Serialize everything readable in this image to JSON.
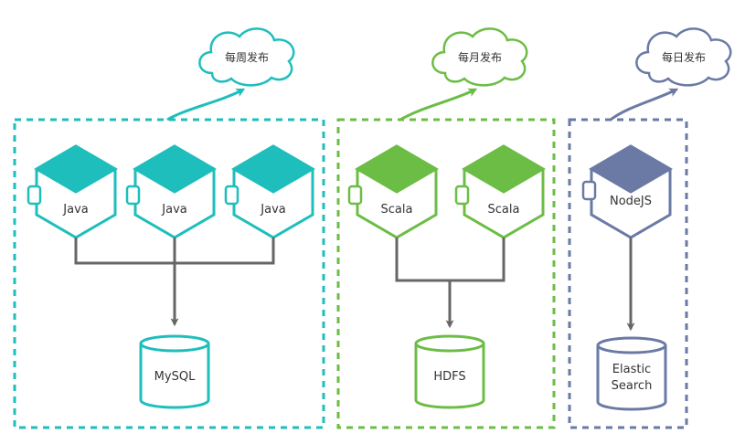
{
  "colors": {
    "teal": "#1ebebc",
    "green": "#6cbd45",
    "slate": "#6a7aa4",
    "connector": "#666666",
    "text": "#333333",
    "background": "#ffffff"
  },
  "groups": [
    {
      "id": "weekly",
      "color": "#1ebebc",
      "cloud_label": "每周发布",
      "services": [
        "Java",
        "Java",
        "Java"
      ],
      "storage": [
        "MySQL"
      ]
    },
    {
      "id": "monthly",
      "color": "#6cbd45",
      "cloud_label": "每月发布",
      "services": [
        "Scala",
        "Scala"
      ],
      "storage": [
        "HDFS"
      ]
    },
    {
      "id": "daily",
      "color": "#6a7aa4",
      "cloud_label": "每日发布",
      "services": [
        "NodeJS"
      ],
      "storage": [
        "Elastic",
        "Search"
      ]
    }
  ]
}
